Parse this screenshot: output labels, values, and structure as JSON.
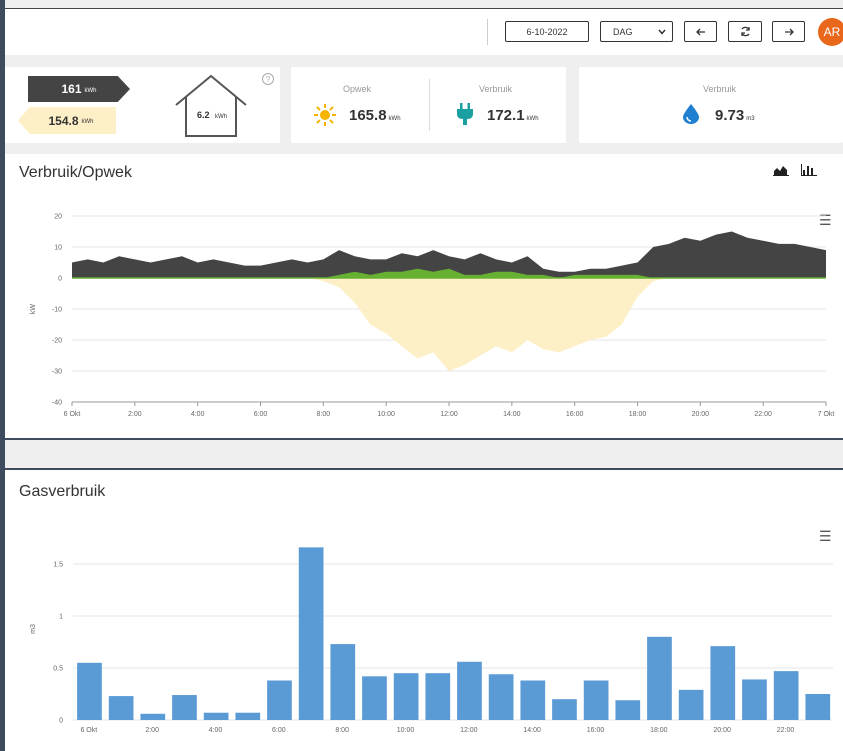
{
  "toolbar": {
    "date": "6-10-2022",
    "period": "DAG",
    "avatar": "AR",
    "icons": {
      "prev": "arrow-left-icon",
      "refresh": "refresh-icon",
      "next": "arrow-right-icon"
    }
  },
  "summary": {
    "grid_out": {
      "value": "161",
      "unit": "kWh"
    },
    "grid_in": {
      "value": "154.8",
      "unit": "kWh"
    },
    "house": {
      "value": "6.2",
      "unit": "kWh"
    },
    "opwek": {
      "label": "Opwek",
      "value": "165.8",
      "unit": "kWh"
    },
    "verbruik": {
      "label": "Verbruik",
      "value": "172.1",
      "unit": "kWh"
    },
    "gas": {
      "label": "Verbruik",
      "value": "9.73",
      "unit": "m3"
    }
  },
  "colors": {
    "dark": "#444444",
    "green": "#66b032",
    "solar": "#fdefc6",
    "blue": "#5b9bd5",
    "accent": "#e8671b"
  },
  "chart_data": [
    {
      "type": "area",
      "title": "Verbruik/Opwek",
      "ylabel": "kW",
      "ylim": [
        -40,
        20
      ],
      "yticks": [
        20,
        10,
        0,
        -10,
        -20,
        -30,
        -40
      ],
      "xticks": [
        "6 Okt",
        "2:00",
        "4:00",
        "6:00",
        "8:00",
        "10:00",
        "12:00",
        "14:00",
        "16:00",
        "18:00",
        "20:00",
        "22:00",
        "7 Okt"
      ],
      "x": [
        "00:00",
        "00:30",
        "01:00",
        "01:30",
        "02:00",
        "02:30",
        "03:00",
        "03:30",
        "04:00",
        "04:30",
        "05:00",
        "05:30",
        "06:00",
        "06:30",
        "07:00",
        "07:30",
        "08:00",
        "08:30",
        "09:00",
        "09:30",
        "10:00",
        "10:30",
        "11:00",
        "11:30",
        "12:00",
        "12:30",
        "13:00",
        "13:30",
        "14:00",
        "14:30",
        "15:00",
        "15:30",
        "16:00",
        "16:30",
        "17:00",
        "17:30",
        "18:00",
        "18:30",
        "19:00",
        "19:30",
        "20:00",
        "20:30",
        "21:00",
        "21:30",
        "22:00",
        "22:30",
        "23:00",
        "23:30",
        "24:00"
      ],
      "series": [
        {
          "values": [
            5,
            6,
            5,
            7,
            6,
            5,
            6,
            7,
            5,
            6,
            5,
            4,
            4,
            5,
            6,
            5,
            6,
            9,
            7,
            6,
            6,
            8,
            7,
            9,
            7,
            6,
            8,
            6,
            5,
            7,
            3,
            2,
            2,
            3,
            3,
            4,
            5,
            10,
            11,
            13,
            12,
            14,
            15,
            13,
            12,
            11,
            11,
            10,
            9
          ]
        },
        {
          "values": [
            0,
            0,
            0,
            0,
            0,
            0,
            0,
            0,
            0,
            0,
            0,
            0,
            0,
            0,
            0,
            0,
            -1,
            -3,
            -8,
            -15,
            -18,
            -22,
            -26,
            -24,
            -30,
            -28,
            -25,
            -22,
            -24,
            -20,
            -23,
            -24,
            -22,
            -20,
            -19,
            -15,
            -6,
            -1,
            0,
            0,
            0,
            0,
            0,
            0,
            0,
            0,
            0,
            0,
            0
          ]
        },
        {
          "values": [
            0,
            0,
            0,
            0,
            0,
            0,
            0,
            0,
            0,
            0,
            0,
            0,
            0,
            0,
            0,
            0,
            0,
            1,
            2,
            1,
            2,
            2,
            3,
            2,
            3,
            1,
            1,
            2,
            2,
            1,
            1,
            0,
            1,
            1,
            1,
            1,
            1,
            0,
            0,
            0,
            0,
            0,
            0,
            0,
            0,
            0,
            0,
            0,
            0
          ]
        }
      ]
    },
    {
      "type": "bar",
      "title": "Gasverbruik",
      "ylabel": "m3",
      "ylim": [
        0,
        1.75
      ],
      "yticks": [
        "0",
        "0.5",
        "1",
        "1.5"
      ],
      "xticks": [
        "6 Okt",
        "2:00",
        "4:00",
        "6:00",
        "8:00",
        "10:00",
        "12:00",
        "14:00",
        "16:00",
        "18:00",
        "20:00",
        "22:00"
      ],
      "values": [
        0.55,
        0.23,
        0.06,
        0.24,
        0.07,
        0.07,
        0.38,
        1.66,
        0.73,
        0.42,
        0.45,
        0.45,
        0.56,
        0.44,
        0.38,
        0.2,
        0.38,
        0.19,
        0.8,
        0.29,
        0.71,
        0.39,
        0.47,
        0.25
      ]
    }
  ]
}
